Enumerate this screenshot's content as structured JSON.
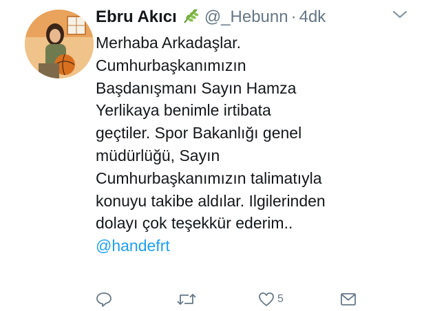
{
  "tweet": {
    "author_name": "Ebru Akıcı",
    "badge_icon": "leaf-emoji-icon",
    "handle": "@_Hebunn",
    "separator": "·",
    "timestamp": "4dk",
    "text_lines": [
      "Merhaba Arkadaşlar.",
      "Cumhurbaşkanımızın",
      "Başdanışmanı Sayın Hamza",
      "Yerlikaya benimle irtibata",
      "geçtiler. Spor Bakanlığı genel",
      "müdürlüğü, Sayın",
      "Cumhurbaşkanımızın talimatıyla",
      "konuyu takibe aldılar. Ilgilerinden",
      "dolayı çok teşekkür ederim.."
    ],
    "mention": "@handefrt"
  },
  "actions": {
    "reply_icon": "reply-icon",
    "retweet_icon": "retweet-icon",
    "like_icon": "heart-icon",
    "like_count": "5",
    "dm_icon": "envelope-icon"
  },
  "colors": {
    "link": "#1da1f2",
    "secondary": "#657786",
    "text": "#14171a",
    "avatar_bg": "#e8b070"
  }
}
